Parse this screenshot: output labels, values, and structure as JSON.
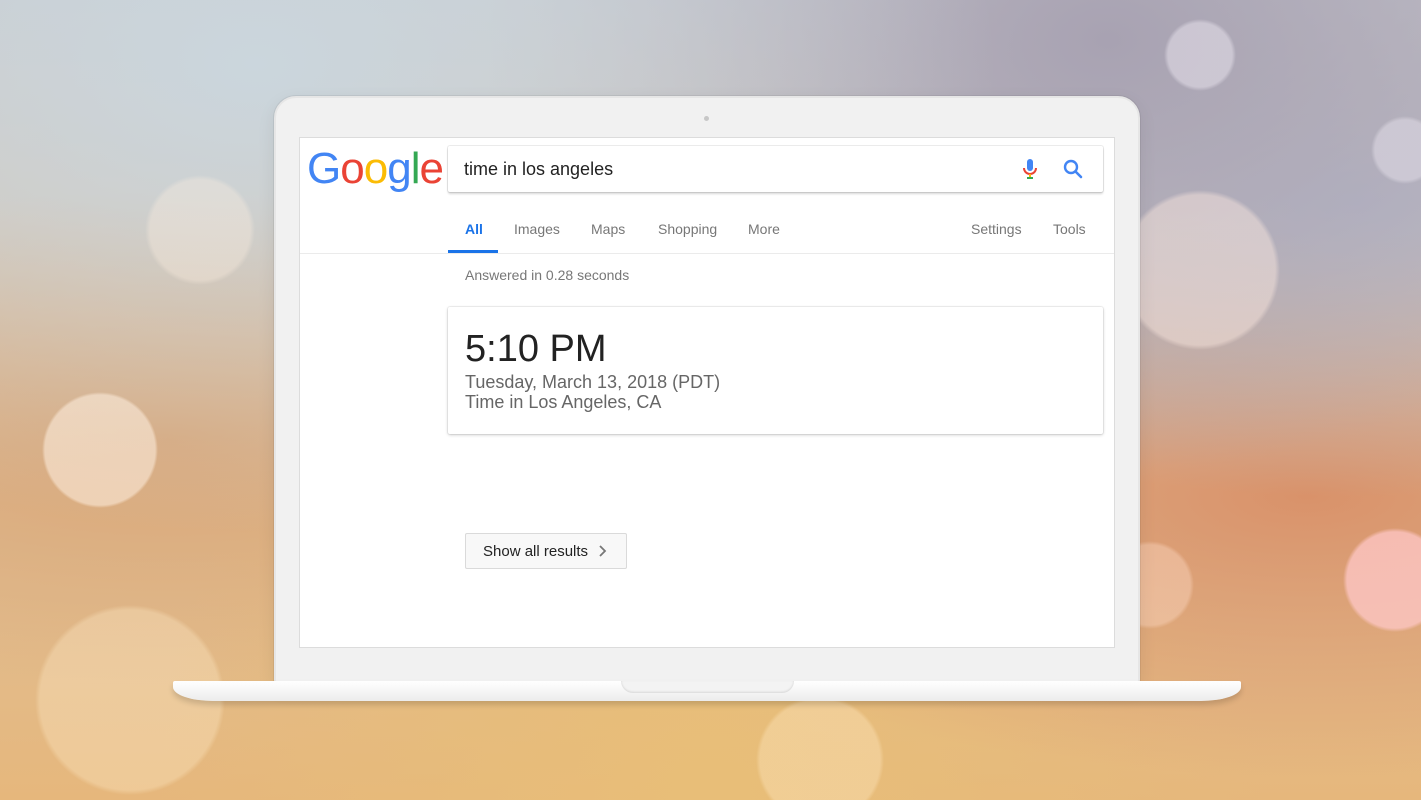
{
  "logo": {
    "text": "Google",
    "letters": [
      {
        "char": "G",
        "color": "#4285F4"
      },
      {
        "char": "o",
        "color": "#EA4335"
      },
      {
        "char": "o",
        "color": "#FBBC05"
      },
      {
        "char": "g",
        "color": "#4285F4"
      },
      {
        "char": "l",
        "color": "#34A853"
      },
      {
        "char": "e",
        "color": "#EA4335"
      }
    ]
  },
  "search": {
    "value": "time in los angeles",
    "mic_icon": "microphone-icon",
    "search_icon": "magnifier-icon"
  },
  "tabs": {
    "all": "All",
    "images": "Images",
    "maps": "Maps",
    "shopping": "Shopping",
    "more": "More",
    "settings": "Settings",
    "tools": "Tools",
    "active": "All"
  },
  "stats": "Answered in 0.28 seconds",
  "answer": {
    "time": "5:10 PM",
    "date": "Tuesday, March 13, 2018 (PDT)",
    "location": "Time in Los Angeles, CA"
  },
  "show_all": {
    "label": "Show all results",
    "icon": "chevron-right-icon"
  },
  "colors": {
    "accent": "#1a73e8",
    "mic_blue": "#4285F4",
    "mic_red": "#EA4335",
    "mic_yellow": "#FBBC05",
    "mic_green": "#34A853"
  }
}
